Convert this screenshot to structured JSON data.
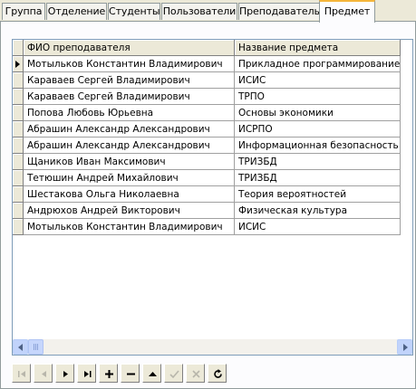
{
  "tabs": [
    {
      "label": "Группа"
    },
    {
      "label": "Отделение"
    },
    {
      "label": "Студенты"
    },
    {
      "label": "Пользователи"
    },
    {
      "label": "Преподаватель"
    },
    {
      "label": "Предмет",
      "active": true
    }
  ],
  "grid": {
    "columns": [
      "ФИО преподавателя",
      "Название предмета"
    ],
    "rows": [
      [
        "Мотыльков Константин Владимирович",
        "Прикладное программирование"
      ],
      [
        "Караваев Сергей Владимирович",
        "ИСИС"
      ],
      [
        "Караваев Сергей Владимирович",
        "ТРПО"
      ],
      [
        "Попова Любовь Юрьевна",
        "Основы экономики"
      ],
      [
        "Абрашин Александр Александрович",
        "ИСРПО"
      ],
      [
        "Абрашин Александр Александрович",
        "Информационная безопасность"
      ],
      [
        "Щаников Иван Максимович",
        "ТРИЗБД"
      ],
      [
        "Тетюшин Андрей Михайлович",
        "ТРИЗБД"
      ],
      [
        "Шестакова Ольга Николаевна",
        "Теория вероятностей"
      ],
      [
        "Андрюхов Андрей Викторович",
        "Физическая культура"
      ],
      [
        "Мотыльков Константин Владимирович",
        "ИСИС"
      ]
    ],
    "current_row": 0
  },
  "navigator": [
    {
      "name": "first-record",
      "label": "|◀",
      "enabled": false
    },
    {
      "name": "prior-record",
      "label": "◀",
      "enabled": false
    },
    {
      "name": "next-record",
      "label": "▶",
      "enabled": true
    },
    {
      "name": "last-record",
      "label": "▶|",
      "enabled": true
    },
    {
      "name": "insert-record",
      "label": "+",
      "enabled": true
    },
    {
      "name": "delete-record",
      "label": "−",
      "enabled": true
    },
    {
      "name": "edit-record",
      "label": "▲",
      "enabled": true
    },
    {
      "name": "post-edit",
      "label": "✓",
      "enabled": false
    },
    {
      "name": "cancel-edit",
      "label": "✕",
      "enabled": false
    },
    {
      "name": "refresh-data",
      "label": "↻",
      "enabled": true
    }
  ],
  "colors": {
    "accent_tab": "#f5b53a",
    "border": "#919b9c",
    "scroll": "#c1d3fb"
  }
}
